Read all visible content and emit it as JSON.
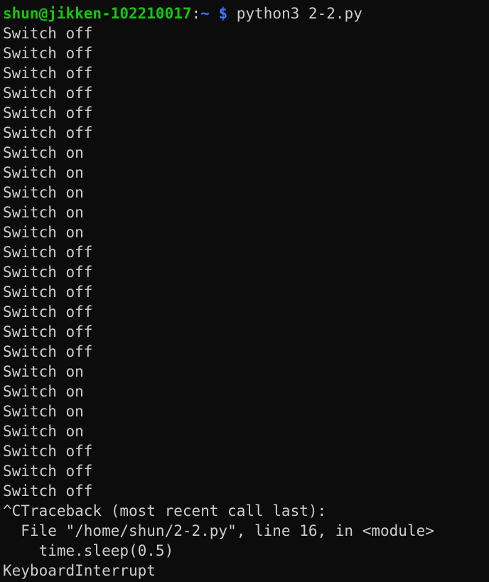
{
  "prompt": {
    "user_host": "shun@jikken-102210017",
    "separator": ":",
    "path": "~",
    "symbol": " $ ",
    "command": "python3 2-2.py"
  },
  "output": [
    "Switch off",
    "Switch off",
    "Switch off",
    "Switch off",
    "Switch off",
    "Switch off",
    "Switch on",
    "Switch on",
    "Switch on",
    "Switch on",
    "Switch on",
    "Switch off",
    "Switch off",
    "Switch off",
    "Switch off",
    "Switch off",
    "Switch off",
    "Switch on",
    "Switch on",
    "Switch on",
    "Switch on",
    "Switch off",
    "Switch off",
    "Switch off"
  ],
  "traceback": [
    "^CTraceback (most recent call last):",
    "  File \"/home/shun/2-2.py\", line 16, in <module>",
    "    time.sleep(0.5)",
    "KeyboardInterrupt"
  ],
  "colors": {
    "background": "#0c0c0c",
    "text": "#cccccc",
    "prompt_user": "#16c60c",
    "prompt_path": "#3b78ff"
  }
}
